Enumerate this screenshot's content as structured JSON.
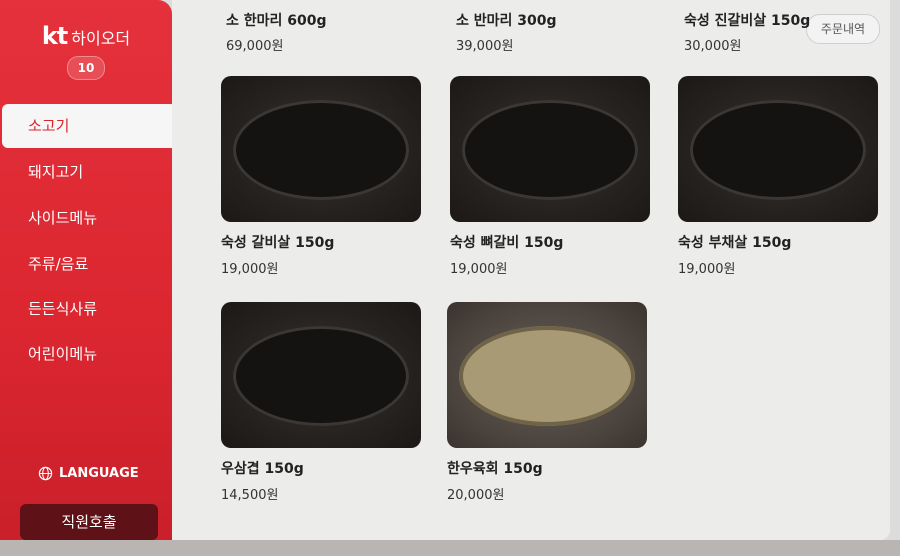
{
  "brand": {
    "logo": "kt",
    "name": "하이오더",
    "table_number": "10"
  },
  "sidebar": {
    "items": [
      {
        "label": "소고기",
        "active": true
      },
      {
        "label": "돼지고기"
      },
      {
        "label": "사이드메뉴"
      },
      {
        "label": "주류/음료"
      },
      {
        "label": "든든식사류"
      },
      {
        "label": "어린이메뉴"
      }
    ],
    "language_label": "LANGUAGE",
    "staff_call_label": "직원호출"
  },
  "header": {
    "order_history_label": "주문내역"
  },
  "top_row": [
    {
      "name": "소 한마리 600g",
      "price": "69,000원"
    },
    {
      "name": "소 반마리 300g",
      "price": "39,000원"
    },
    {
      "name": "숙성 진갈비살 150g",
      "price": "30,000원"
    }
  ],
  "menu": [
    {
      "name": "숙성 갈비살 150g",
      "price": "19,000원"
    },
    {
      "name": "숙성 뼈갈비 150g",
      "price": "19,000원"
    },
    {
      "name": "숙성 부채살 150g",
      "price": "19,000원"
    },
    {
      "name": "우삼겹 150g",
      "price": "14,500원"
    },
    {
      "name": "한우육회 150g",
      "price": "20,000원"
    }
  ],
  "colors": {
    "brand_red": "#e0262f",
    "staff_button": "#5e1116"
  }
}
